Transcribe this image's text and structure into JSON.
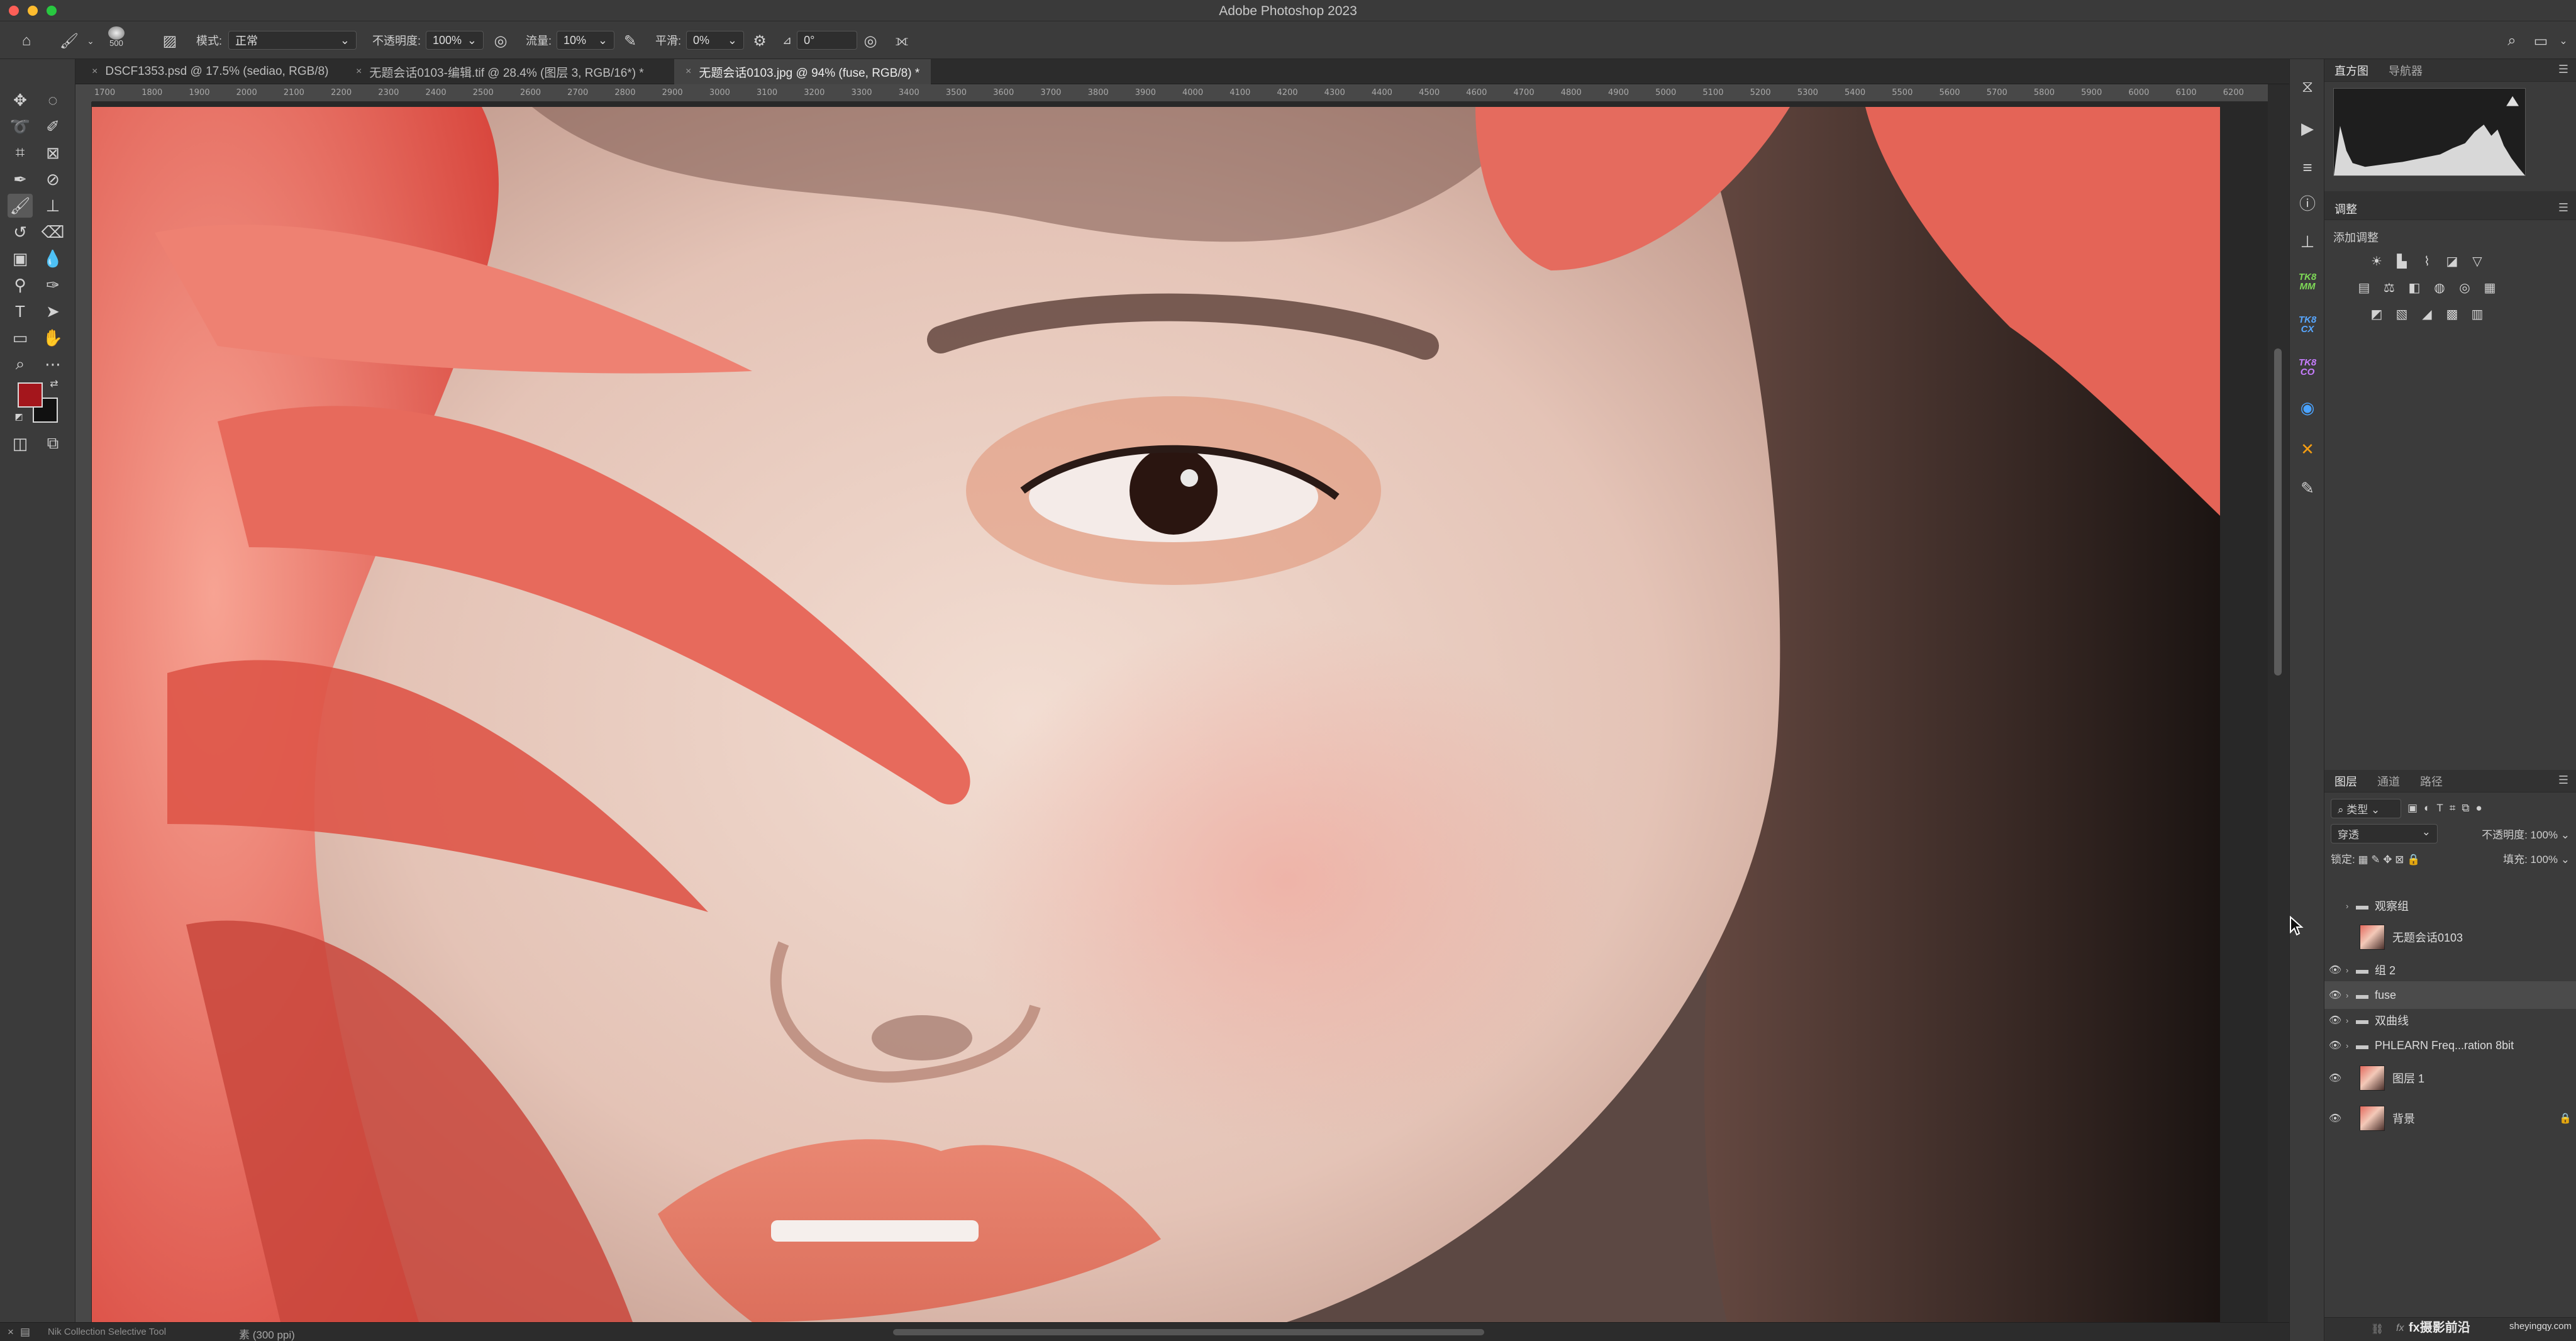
{
  "window": {
    "title": "Adobe Photoshop 2023"
  },
  "options_bar": {
    "brush_size": "500",
    "mode_label": "模式:",
    "mode_value": "正常",
    "opacity_label": "不透明度:",
    "opacity_value": "100%",
    "flow_label": "流量:",
    "flow_value": "10%",
    "smoothing_label": "平滑:",
    "smoothing_value": "0%",
    "angle_value": "0°"
  },
  "document_tabs": [
    {
      "label": "DSCF1353.psd @ 17.5% (sediao, RGB/8)",
      "active": false
    },
    {
      "label": "无题会话0103-编辑.tif @ 28.4% (图层 3, RGB/16*) *",
      "active": false
    },
    {
      "label": "无题会话0103.jpg @ 94% (fuse, RGB/8) *",
      "active": true
    }
  ],
  "ruler_ticks": [
    "1700",
    "1800",
    "1900",
    "2000",
    "2100",
    "2200",
    "2300",
    "2400",
    "2500",
    "2600",
    "2700",
    "2800",
    "2900",
    "3000",
    "3100",
    "3200",
    "3300",
    "3400",
    "3500",
    "3600",
    "3700",
    "3800",
    "3900",
    "4000",
    "4100",
    "4200",
    "4300",
    "4400",
    "4500",
    "4600",
    "4700",
    "4800",
    "4900",
    "5000",
    "5100",
    "5200",
    "5300",
    "5400",
    "5500",
    "5600",
    "5700",
    "5800",
    "5900",
    "6000",
    "6100",
    "6200"
  ],
  "status_bar": {
    "plugin_label": "Nik Collection Selective Tool",
    "zoom_info": "素 (300 ppi)"
  },
  "panels": {
    "histogram": {
      "tabs": [
        "直方图",
        "导航器"
      ]
    },
    "adjustments": {
      "tab": "调整",
      "add_label": "添加调整"
    },
    "layers": {
      "tabs": [
        "图层",
        "通道",
        "路径"
      ],
      "filter_label": "类型",
      "blend_mode": "穿透",
      "opacity_label": "不透明度:",
      "opacity_value": "100%",
      "lock_label": "锁定:",
      "fill_label": "填充:",
      "fill_value": "100%",
      "items": [
        {
          "name": "观察组",
          "type": "group",
          "visible": false,
          "selected": false,
          "locked": false
        },
        {
          "name": "无题会话0103",
          "type": "image",
          "visible": false,
          "selected": false,
          "locked": false
        },
        {
          "name": "组 2",
          "type": "group",
          "visible": true,
          "selected": false,
          "locked": false
        },
        {
          "name": "fuse",
          "type": "group",
          "visible": true,
          "selected": true,
          "locked": false
        },
        {
          "name": "双曲线",
          "type": "group",
          "visible": true,
          "selected": false,
          "locked": false
        },
        {
          "name": "PHLEARN Freq...ration 8bit",
          "type": "group",
          "visible": true,
          "selected": false,
          "locked": false
        },
        {
          "name": "图层 1",
          "type": "image",
          "visible": true,
          "selected": false,
          "locked": false
        },
        {
          "name": "背景",
          "type": "image",
          "visible": true,
          "selected": false,
          "locked": true
        }
      ]
    }
  },
  "dock_tk": [
    "TK8\nMM",
    "TK8\nCX",
    "TK8\nCO"
  ],
  "watermark": {
    "text": "fx摄影前沿",
    "sub": "sheyingqy.com"
  }
}
